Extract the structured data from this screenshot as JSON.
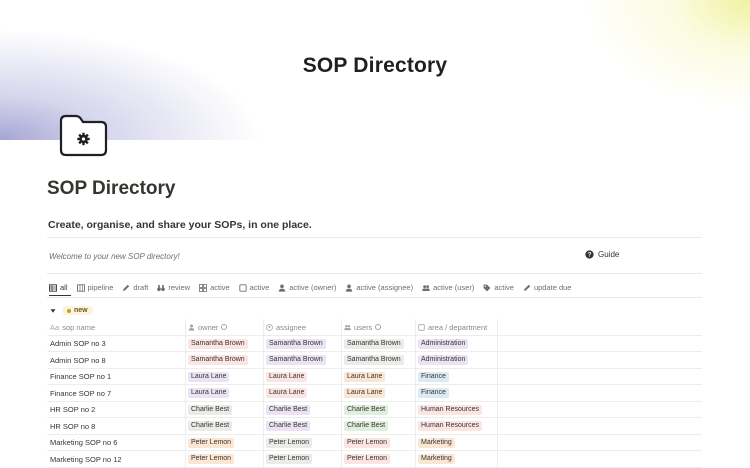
{
  "cover": {
    "title": "SOP Directory"
  },
  "page": {
    "title": "SOP Directory",
    "subtitle": "Create, organise, and share your SOPs, in one place."
  },
  "callout": {
    "welcome": "Welcome to your new SOP directory!",
    "guide_label": "Guide"
  },
  "tabs": [
    {
      "label": "all",
      "icon": "table-icon",
      "active": true
    },
    {
      "label": "pipeline",
      "icon": "board-icon"
    },
    {
      "label": "draft",
      "icon": "pencil-icon"
    },
    {
      "label": "review",
      "icon": "binoculars-icon"
    },
    {
      "label": "active",
      "icon": "gallery-icon"
    },
    {
      "label": "active",
      "icon": "checkbox-icon"
    },
    {
      "label": "active (owner)",
      "icon": "person-icon"
    },
    {
      "label": "active (assignee)",
      "icon": "person-icon"
    },
    {
      "label": "active (user)",
      "icon": "people-icon"
    },
    {
      "label": "active",
      "icon": "tag-icon"
    },
    {
      "label": "update due",
      "icon": "pencil-icon"
    }
  ],
  "group": {
    "label": "new"
  },
  "columns": {
    "name": "sop name",
    "owner": "owner",
    "assignee": "assignee",
    "users": "users",
    "area": "area / department",
    "name_prefix": "Aa"
  },
  "colors": {
    "red": "#fbe4e4",
    "purple": "#ebe3f5",
    "gray": "#ebebea",
    "orange": "#fbe6d4",
    "green": "#dfeedd",
    "blue": "#dbeaf5",
    "yellow": "#fbf3db"
  },
  "rows": [
    {
      "name": "Admin SOP no 3",
      "owner": "Samantha Brown",
      "owner_color": "red",
      "assignee": "Samantha Brown",
      "assignee_color": "purple",
      "users": "Samantha Brown",
      "users_color": "gray",
      "area": "Administration",
      "area_color": "purple"
    },
    {
      "name": "Admin SOP no 8",
      "owner": "Samantha Brown",
      "owner_color": "red",
      "assignee": "Samantha Brown",
      "assignee_color": "purple",
      "users": "Samantha Brown",
      "users_color": "gray",
      "area": "Administration",
      "area_color": "purple"
    },
    {
      "name": "Finance SOP no 1",
      "owner": "Laura Lane",
      "owner_color": "purple",
      "assignee": "Laura Lane",
      "assignee_color": "red",
      "users": "Laura Lane",
      "users_color": "orange",
      "area": "Finance",
      "area_color": "blue"
    },
    {
      "name": "Finance SOP no 7",
      "owner": "Laura Lane",
      "owner_color": "purple",
      "assignee": "Laura Lane",
      "assignee_color": "red",
      "users": "Laura Lane",
      "users_color": "orange",
      "area": "Finance",
      "area_color": "blue"
    },
    {
      "name": "HR SOP no 2",
      "owner": "Charlie Best",
      "owner_color": "gray",
      "assignee": "Charlie Best",
      "assignee_color": "purple",
      "users": "Charlie Best",
      "users_color": "green",
      "area": "Human Resources",
      "area_color": "red"
    },
    {
      "name": "HR SOP no 8",
      "owner": "Charlie Best",
      "owner_color": "gray",
      "assignee": "Charlie Best",
      "assignee_color": "purple",
      "users": "Charlie Best",
      "users_color": "green",
      "area": "Human Resources",
      "area_color": "red"
    },
    {
      "name": "Marketing SOP no 6",
      "owner": "Peter Lemon",
      "owner_color": "orange",
      "assignee": "Peter Lemon",
      "assignee_color": "gray",
      "users": "Peter Lemon",
      "users_color": "red",
      "area": "Marketing",
      "area_color": "orange"
    },
    {
      "name": "Marketing SOP no 12",
      "owner": "Peter Lemon",
      "owner_color": "orange",
      "assignee": "Peter Lemon",
      "assignee_color": "gray",
      "users": "Peter Lemon",
      "users_color": "red",
      "area": "Marketing",
      "area_color": "orange"
    }
  ]
}
